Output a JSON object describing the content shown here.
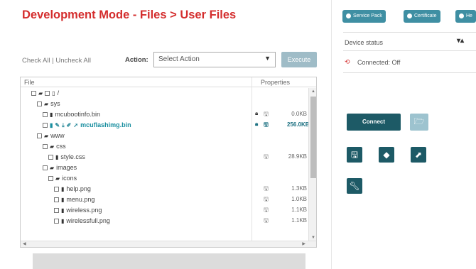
{
  "title": "Development Mode - Files > User Files",
  "toolbar": {
    "check_all": "Check All",
    "separator": " | ",
    "uncheck_all": "Uncheck All",
    "action_label": "Action:",
    "action_value": "Select Action",
    "execute_label": "Execute"
  },
  "tree": {
    "col_file": "File",
    "col_properties": "Properties",
    "rows": [
      {
        "name": "/",
        "type": "root"
      },
      {
        "name": "sys",
        "type": "folder"
      },
      {
        "name": "mcubootinfo.bin",
        "type": "file",
        "size": "0.0KB",
        "locked": true
      },
      {
        "name": "mcuflashimg.bin",
        "type": "file",
        "size": "256.0KB",
        "locked": true,
        "active": true
      },
      {
        "name": "www",
        "type": "folder"
      },
      {
        "name": "css",
        "type": "folder"
      },
      {
        "name": "style.css",
        "type": "file",
        "size": "28.9KB"
      },
      {
        "name": "images",
        "type": "folder"
      },
      {
        "name": "icons",
        "type": "folder"
      },
      {
        "name": "help.png",
        "type": "file",
        "size": "1.3KB"
      },
      {
        "name": "menu.png",
        "type": "file",
        "size": "1.0KB"
      },
      {
        "name": "wireless.png",
        "type": "file",
        "size": "1.1KB"
      },
      {
        "name": "wirelessfull.png",
        "type": "file",
        "size": "1.1KB"
      }
    ]
  },
  "right": {
    "buttons": [
      "Service Pack",
      "Certificate",
      "He"
    ],
    "device_status_label": "Device status",
    "connected_text": "Connected: Off",
    "connect_label": "Connect"
  },
  "icons": {
    "folder": "folder-icon",
    "file": "file-icon",
    "lock": "lock-icon",
    "disk": "save-icon"
  },
  "colors": {
    "title": "#d42d2d",
    "accent": "#1a8fa0",
    "dark_teal": "#1d5a66",
    "button": "#3f8fa3"
  }
}
